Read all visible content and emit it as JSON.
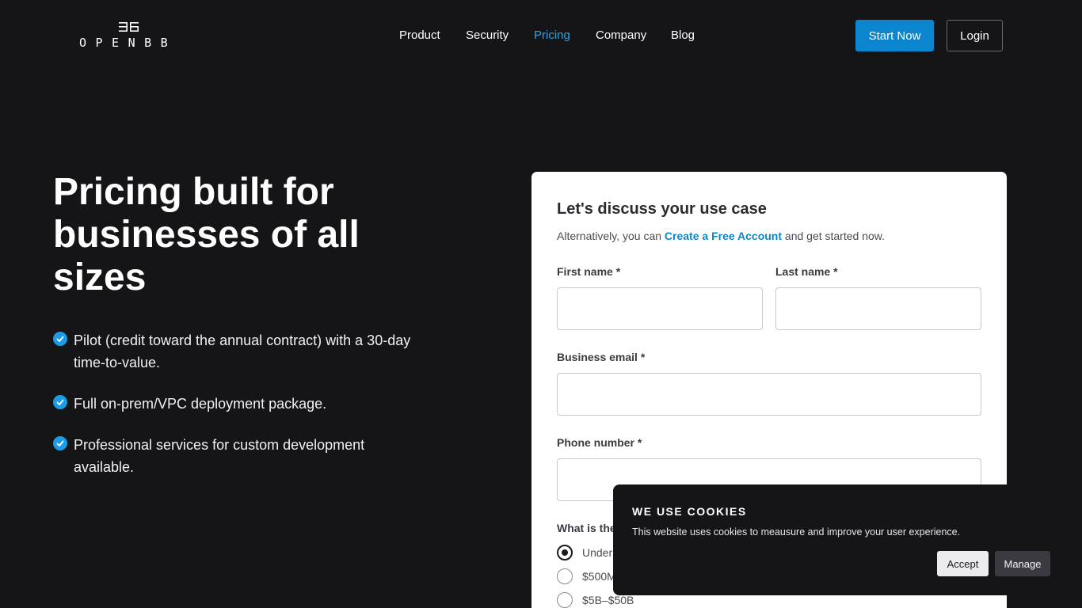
{
  "header": {
    "logo_text": "OPENBB",
    "nav": [
      {
        "label": "Product",
        "active": false
      },
      {
        "label": "Security",
        "active": false
      },
      {
        "label": "Pricing",
        "active": true
      },
      {
        "label": "Company",
        "active": false
      },
      {
        "label": "Blog",
        "active": false
      }
    ],
    "start_label": "Start Now",
    "login_label": "Login"
  },
  "hero": {
    "title": "Pricing built for businesses of all sizes",
    "bullets": [
      "Pilot (credit toward the annual contract) with a 30-day time-to-value.",
      "Full on-prem/VPC deployment package.",
      "Professional services for custom development available."
    ]
  },
  "form": {
    "title": "Let's discuss your use case",
    "sub_prefix": "Alternatively, you can ",
    "sub_link": "Create a Free Account",
    "sub_suffix": " and get started now.",
    "first_name_label": "First name *",
    "last_name_label": "Last name *",
    "email_label": "Business email *",
    "phone_label": "Phone number *",
    "question_label": "What is the",
    "radio_options": [
      {
        "label": "Under",
        "selected": true
      },
      {
        "label": "$500M",
        "selected": false
      },
      {
        "label": "$5B–$50B",
        "selected": false
      }
    ]
  },
  "cookie": {
    "title": "WE USE COOKIES",
    "text": "This website uses cookies to meausure and improve your user experience.",
    "accept_label": "Accept",
    "manage_label": "Manage"
  },
  "colors": {
    "background": "#151518",
    "accent": "#0c85cf",
    "nav_active": "#29a3e6",
    "link": "#0f87c4"
  }
}
